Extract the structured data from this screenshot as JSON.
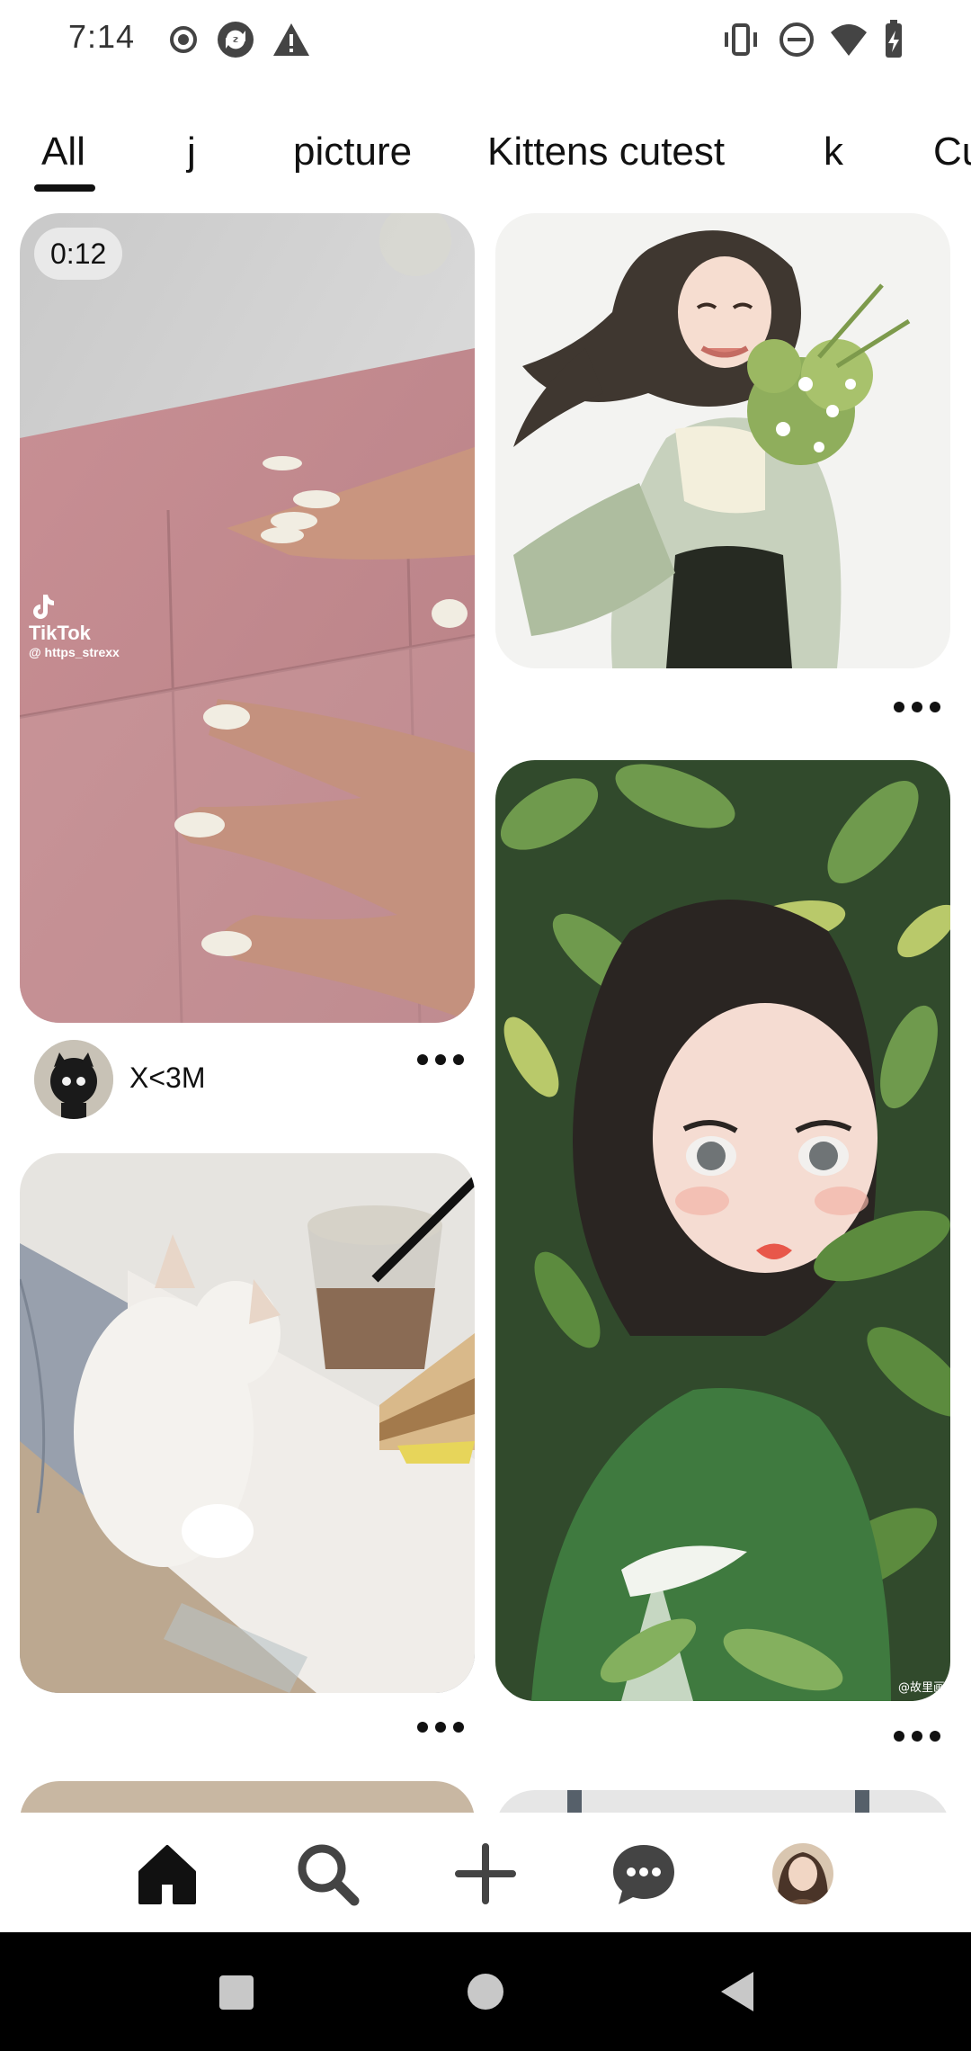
{
  "status_bar": {
    "time": "7:14",
    "left_icons": [
      "record-icon",
      "sync-icon",
      "warning-icon"
    ],
    "right_icons": [
      "vibrate-icon",
      "do-not-disturb-icon",
      "wifi-icon",
      "battery-icon"
    ]
  },
  "tabs": [
    {
      "label": "All",
      "selected": true
    },
    {
      "label": "j",
      "selected": false
    },
    {
      "label": "picture",
      "selected": false
    },
    {
      "label": "Kittens cutest",
      "selected": false
    },
    {
      "label": "k",
      "selected": false
    },
    {
      "label": "Cu",
      "selected": false
    }
  ],
  "pins": {
    "video": {
      "duration": "0:12",
      "watermark_name": "TikTok",
      "watermark_handle": "@ https_strexx",
      "author_name": "X<3M"
    },
    "girl_bouquet": {},
    "girl_leaves": {
      "watermark": "@故里画"
    },
    "kitten": {}
  },
  "bottom_nav": {
    "items": [
      "home-icon",
      "search-icon",
      "create-icon",
      "messages-icon",
      "profile-avatar"
    ],
    "active": "home"
  },
  "system_nav": {
    "items": [
      "recents-button",
      "home-button",
      "back-button"
    ]
  },
  "colors": {
    "background": "#ffffff",
    "text": "#111111",
    "system_bar": "#000000"
  }
}
